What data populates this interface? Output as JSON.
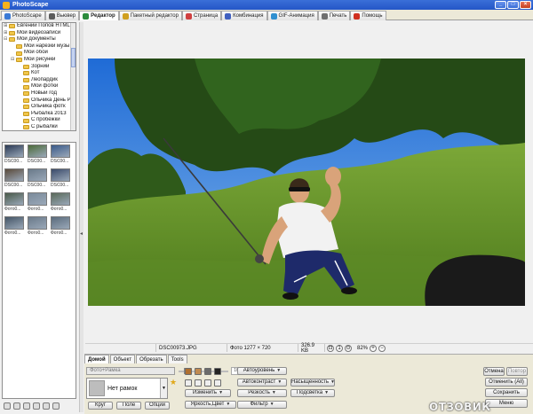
{
  "window": {
    "title": "PhotoScape"
  },
  "tabs": [
    {
      "label": "PhotoScape",
      "color": "#3b7bd6"
    },
    {
      "label": "Вьювер",
      "color": "#5c5c5c"
    },
    {
      "label": "Редактор",
      "color": "#2c8c3c",
      "active": true
    },
    {
      "label": "Пакетный редактор",
      "color": "#d0a020"
    },
    {
      "label": "Страница",
      "color": "#d04040"
    },
    {
      "label": "Комбинация",
      "color": "#4060c0"
    },
    {
      "label": "GIF-Анимация",
      "color": "#3090d0"
    },
    {
      "label": "Печать",
      "color": "#707070"
    },
    {
      "label": "Помощь",
      "color": "#d03020"
    }
  ],
  "tree": {
    "items": [
      {
        "label": "Евгений Попов HTML",
        "indent": 0,
        "sign": "⊞"
      },
      {
        "label": "Мои видеозаписи",
        "indent": 0,
        "sign": "⊞"
      },
      {
        "label": "Мои документы",
        "indent": 0,
        "sign": "⊟"
      },
      {
        "label": "Мои нарезки музы",
        "indent": 1,
        "sign": ""
      },
      {
        "label": "Мои обои",
        "indent": 1,
        "sign": ""
      },
      {
        "label": "Мои рисунки",
        "indent": 1,
        "sign": "⊟"
      },
      {
        "label": "Зорний",
        "indent": 2,
        "sign": ""
      },
      {
        "label": "Кот",
        "indent": 2,
        "sign": ""
      },
      {
        "label": "Леопардик",
        "indent": 2,
        "sign": ""
      },
      {
        "label": "Мои фотки",
        "indent": 2,
        "sign": ""
      },
      {
        "label": "Новый год",
        "indent": 2,
        "sign": ""
      },
      {
        "label": "Ольчика День Р",
        "indent": 2,
        "sign": ""
      },
      {
        "label": "Ольчика фотк",
        "indent": 2,
        "sign": ""
      },
      {
        "label": "Рыбалка 2013",
        "indent": 2,
        "sign": ""
      },
      {
        "label": "С пробежки",
        "indent": 2,
        "sign": ""
      },
      {
        "label": "С рыбалки",
        "indent": 2,
        "sign": ""
      }
    ]
  },
  "thumbnails": [
    {
      "caption": "DSC00...",
      "tone": "#2b3a55"
    },
    {
      "caption": "DSC00...",
      "tone": "#4c6b3a"
    },
    {
      "caption": "DSC00...",
      "tone": "#3a5a8a"
    },
    {
      "caption": "DSC00...",
      "tone": "#5a4a3a"
    },
    {
      "caption": "DSC00...",
      "tone": "#6a7a8a"
    },
    {
      "caption": "DSC00...",
      "tone": "#3a4a6a"
    },
    {
      "caption": "Фото0...",
      "tone": "#4a5a4a"
    },
    {
      "caption": "Фото0...",
      "tone": "#7a8a9a"
    },
    {
      "caption": "Фото0...",
      "tone": "#5a6a5a"
    },
    {
      "caption": "Фото0...",
      "tone": "#445566"
    },
    {
      "caption": "Фото0...",
      "tone": "#6a7a8a"
    },
    {
      "caption": "Фото0...",
      "tone": "#5a6b7c"
    }
  ],
  "status": {
    "filename": "DSC00973.JPG",
    "dimensions": "Фото 1277 × 720",
    "filesize": "326.9 KB",
    "zoom": "82%"
  },
  "editor": {
    "tabs": [
      {
        "label": "Домой",
        "active": true
      },
      {
        "label": "Объект"
      },
      {
        "label": "Обрезать"
      },
      {
        "label": "Tools"
      }
    ],
    "frame_select": "Фото+Рамка",
    "frame_percent": "100%",
    "frame_preview_label": "Нет рамок",
    "shape_buttons": [
      "Круг",
      "Поле",
      "Опции"
    ],
    "mid_buttons": [
      "Изменить",
      "Яркость,Цвет"
    ],
    "auto_buttons": [
      "Автоуровень",
      "Автоконтраст",
      "Резкость",
      "Фильтр"
    ],
    "right_menu_buttons": [
      "Насыщенность",
      "Подсветка"
    ],
    "side_buttons": [
      "Отмена",
      "Повтор",
      "Отменить (All)",
      "Сохранить",
      "Меню"
    ]
  },
  "watermark": "ОТЗОВИК"
}
